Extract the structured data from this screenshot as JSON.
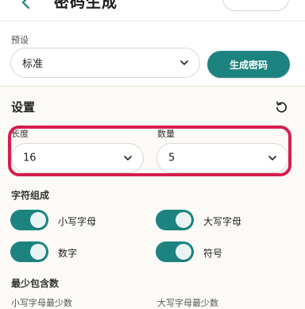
{
  "header": {
    "title": "密码生成"
  },
  "preset": {
    "label": "预设",
    "selected": "标准",
    "generate_label": "生成密码"
  },
  "settings": {
    "title": "设置",
    "length": {
      "label": "长度",
      "value": "16"
    },
    "count": {
      "label": "数量",
      "value": "5"
    }
  },
  "composition": {
    "title": "字符组成",
    "toggles": [
      {
        "label": "小写字母",
        "on": true
      },
      {
        "label": "大写字母",
        "on": true
      },
      {
        "label": "数字",
        "on": true
      },
      {
        "label": "符号",
        "on": true
      }
    ]
  },
  "minimum": {
    "title": "最少包含数",
    "left_label": "小写字母最少数",
    "right_label": "大写字母最少数"
  },
  "colors": {
    "accent": "#1d8380",
    "highlight": "#d61e4e"
  }
}
